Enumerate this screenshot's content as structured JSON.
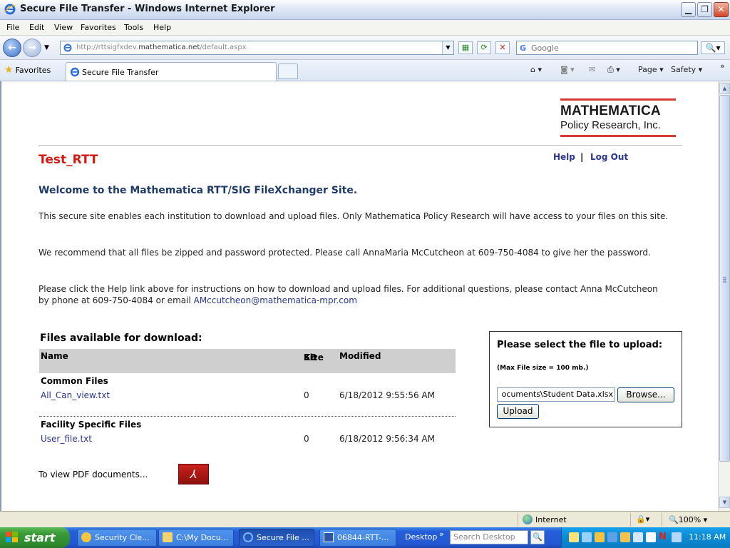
{
  "window": {
    "title": "Secure File Transfer - Windows Internet Explorer"
  },
  "menu": [
    "File",
    "Edit",
    "View",
    "Favorites",
    "Tools",
    "Help"
  ],
  "address": {
    "url_prefix": "http://rttsigfxdev.",
    "url_domain": "mathematica.net",
    "url_suffix": "/default.aspx",
    "search_placeholder": "Google"
  },
  "favorites": {
    "label": "Favorites",
    "tab_label": "Secure File Transfer",
    "page_label": "Page",
    "safety_label": "Safety"
  },
  "logo": {
    "line1": "MATHEMATICA",
    "line2": "Policy Research, Inc."
  },
  "header": {
    "site_title": "Test_RTT",
    "help": "Help",
    "separator": "|",
    "logout": "Log Out"
  },
  "intro": {
    "welcome": "Welcome to the Mathematica RTT/SIG FileXchanger Site.",
    "p1": "This secure site enables each institution to download and upload files. Only Mathematica Policy Research will have access to your files on this site.",
    "p2": "We recommend that all files be zipped and password protected. Please call AnnaMaria McCutcheon at 609-750-4084 to give her the password.",
    "p3a": "Please click the Help link above for instructions on how to download and upload files.  For additional questions, please contact Anna McCutcheon",
    "p3b": "by phone at 609-750-4084 or email",
    "email": "AMccutcheon@mathematica-mpr.com"
  },
  "files": {
    "title": "Files available for download:",
    "col_name": "Name",
    "col_size_1": "Size",
    "col_size_2": "KB",
    "col_modified": "Modified",
    "groups": [
      {
        "name": "Common Files",
        "file": "All_Can_view.txt",
        "size": "0",
        "modified": "6/18/2012 9:55:56 AM"
      },
      {
        "name": "Facility Specific Files",
        "file": "User_file.txt",
        "size": "0",
        "modified": "6/18/2012 9:56:34 AM"
      }
    ]
  },
  "pdf": {
    "text": "To view PDF documents..."
  },
  "upload": {
    "title": "Please select the file to upload:",
    "note": "(Max File size = 100 mb.)",
    "file_value": "ocuments\\Student Data.xlsx",
    "browse": "Browse...",
    "upload": "Upload"
  },
  "status": {
    "zone": "Internet",
    "zoom": "100%"
  },
  "taskbar": {
    "start": "start",
    "tasks": [
      "Security Cle...",
      "C:\\My Docu...",
      "Secure File ...",
      "06844-RTT-..."
    ],
    "desktop": "Desktop",
    "search_placeholder": "Search Desktop",
    "clock": "11:18 AM"
  },
  "colors": {
    "title_red": "#d01a14",
    "link_blue": "#2a3590",
    "heading_navy": "#1f3b6a",
    "logo_red": "#d63a37"
  }
}
